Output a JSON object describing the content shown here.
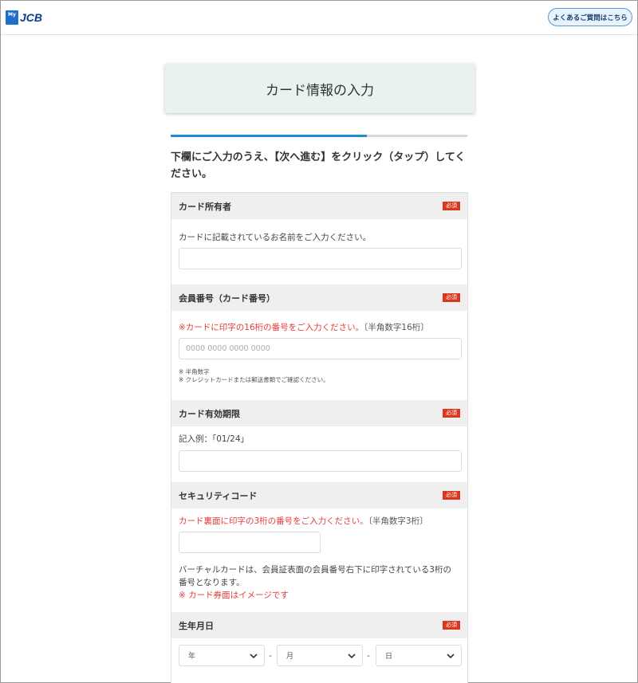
{
  "header": {
    "logo_my": "My",
    "logo_jcb": "JCB",
    "faq_button": "よくあるご質問はこちら"
  },
  "page": {
    "title": "カード情報の入力",
    "progress": 0.66,
    "instruction": "下欄にご入力のうえ、【次へ進む】をクリック（タップ）してください。"
  },
  "required_badge": "必須",
  "sections": {
    "holder": {
      "title": "カード所有者",
      "hint": "カードに記載されているお名前をご入力ください。",
      "value": ""
    },
    "card_number": {
      "title": "会員番号（カード番号）",
      "hint_red": "※カードに印字の16桁の番号をご入力ください。",
      "hint_gray": "〔半角数字16桁〕",
      "placeholder": "0000 0000 0000 0000",
      "note1": "※ 半角数字",
      "note2": "※ クレジットカードまたは郵送書類でご確認ください。"
    },
    "expiry": {
      "title": "カード有効期限",
      "hint": "記入例：｢01/24｣",
      "value": ""
    },
    "security": {
      "title": "セキュリティコード",
      "hint_red": "カード裏面に印字の3桁の番号をご入力ください。",
      "hint_gray": "〔半角数字3桁〕",
      "value": "",
      "desc_line1": "バーチャルカードは、会員証表面の会員番号右下に印字されている3桁の",
      "desc_line2": "番号となります。",
      "note_red": "※ カード券面はイメージです"
    },
    "birth": {
      "title": "生年月日",
      "year": "年",
      "month": "月",
      "day": "日",
      "separator": "-"
    }
  }
}
